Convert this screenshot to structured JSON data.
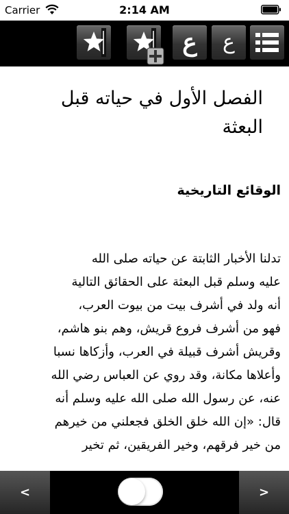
{
  "status_bar": {
    "carrier": "Carrier",
    "time": "2:14 AM",
    "icons": [
      "wifi-icon",
      "battery-icon"
    ]
  },
  "toolbar": {
    "buttons": [
      {
        "name": "bookmark-button",
        "icon": "star-bookmark-icon"
      },
      {
        "name": "add-bookmark-button",
        "icon": "star-bookmark-plus-icon"
      },
      {
        "name": "font-large-button",
        "label": "ع"
      },
      {
        "name": "font-small-button",
        "label": "ع"
      },
      {
        "name": "menu-button",
        "icon": "list-icon"
      }
    ]
  },
  "content": {
    "chapter_title": "الفصل الأول في حياته قبل البعثة",
    "section_title": "الوقائع التاريخية",
    "lines": [
      "تدلنا الأخبار الثابتة عن حياته صلى الله",
      "عليه وسلم قبل البعثة على الحقائق التالية",
      "أنه ولد في أشرف بيت من بيوت العرب،",
      "فهو من أشرف فروع قريش، وهم بنو هاشم،",
      "وقريش أشرف قبيلة في العرب، وأزكاها نسبا",
      "وأعلاها مكانة، وقد روي عن العباس رضي الله",
      "عنه، عن رسول الله صلى الله عليه وسلم أنه",
      "قال: «إن الله خلق الخلق فجعلني من خيرهم",
      "من خير فرقهم، وخير الفريقين، ثم تخير"
    ]
  },
  "bottom_bar": {
    "prev_label": "<",
    "next_label": ">",
    "toggle_on": false
  }
}
